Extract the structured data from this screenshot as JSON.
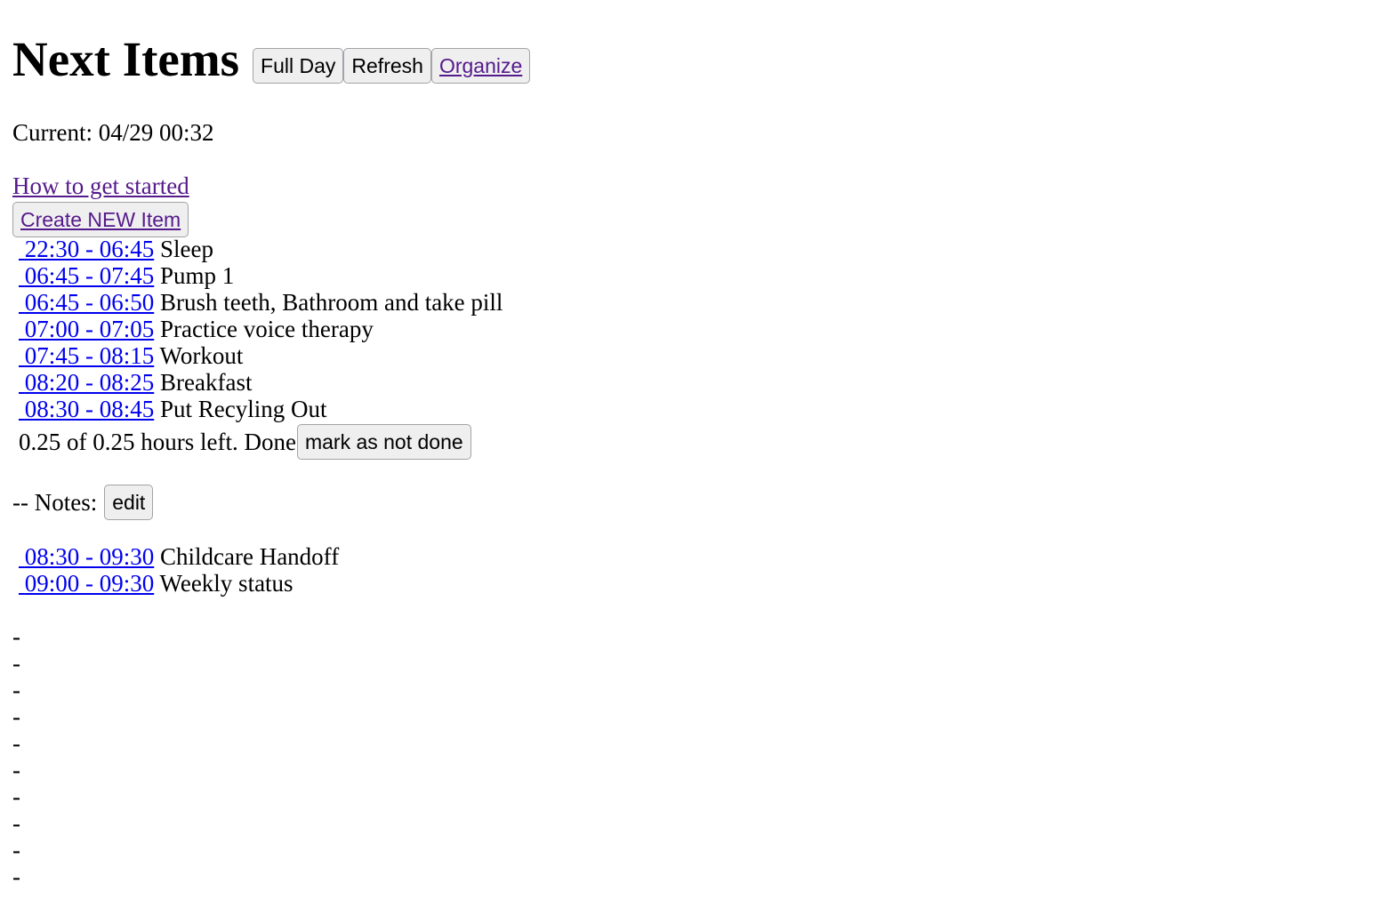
{
  "header": {
    "title": "Next Items",
    "buttons": {
      "full_day": "Full Day",
      "refresh": "Refresh",
      "organize": "Organize"
    }
  },
  "current": {
    "label": "Current:",
    "datetime": "04/29 00:32"
  },
  "links": {
    "how_to": "How to get started",
    "create_new": "Create NEW Item"
  },
  "schedule_top": [
    {
      "time": "22:30 - 06:45",
      "name": "Sleep"
    },
    {
      "time": "06:45 - 07:45",
      "name": "Pump 1"
    },
    {
      "time": "06:45 - 06:50",
      "name": "Brush teeth, Bathroom and take pill"
    },
    {
      "time": "07:00 - 07:05",
      "name": "Practice voice therapy"
    },
    {
      "time": "07:45 - 08:15",
      "name": "Workout"
    },
    {
      "time": "08:20 - 08:25",
      "name": "Breakfast"
    },
    {
      "time": "08:30 - 08:45",
      "name": "Put Recyling Out"
    }
  ],
  "selected_item": {
    "status_text": "0.25 of 0.25 hours left. Done",
    "mark_button": "mark as not done",
    "notes_label": "-- Notes:",
    "edit_button": "edit"
  },
  "schedule_bottom": [
    {
      "time": "08:30 - 09:30",
      "name": "Childcare Handoff"
    },
    {
      "time": "09:00 - 09:30",
      "name": "Weekly status"
    }
  ],
  "empty_slots": [
    "-",
    "-",
    "-",
    "-",
    "-",
    "-",
    "-",
    "-",
    "-",
    "-"
  ]
}
